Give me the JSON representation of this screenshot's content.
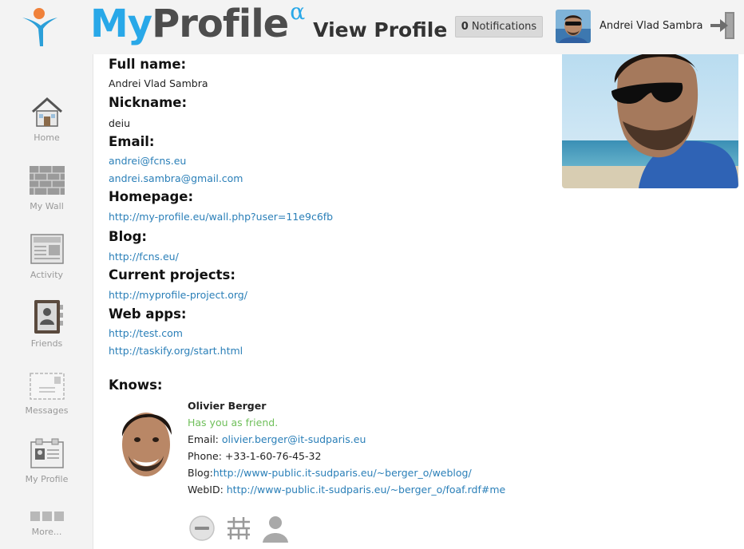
{
  "header": {
    "brand_my": "My",
    "brand_profile": "Profile",
    "brand_alpha": "α",
    "page_title": "View Profile",
    "notifications_count": "0",
    "notifications_label": "Notifications",
    "user_name": "Andrei Vlad Sambra"
  },
  "sidebar": {
    "items": [
      {
        "label": "Home",
        "icon": "house-icon"
      },
      {
        "label": "My Wall",
        "icon": "brick-wall-icon"
      },
      {
        "label": "Activity",
        "icon": "newspaper-icon"
      },
      {
        "label": "Friends",
        "icon": "address-book-icon"
      },
      {
        "label": "Messages",
        "icon": "envelope-icon"
      },
      {
        "label": "My Profile",
        "icon": "id-card-icon"
      },
      {
        "label": "More...",
        "icon": "more-icon"
      }
    ]
  },
  "profile": {
    "full_name_label": "Full name:",
    "full_name": "Andrei Vlad Sambra",
    "nickname_label": "Nickname:",
    "nickname": "deiu",
    "email_label": "Email:",
    "emails": [
      "andrei@fcns.eu",
      "andrei.sambra@gmail.com"
    ],
    "homepage_label": "Homepage:",
    "homepage": "http://my-profile.eu/wall.php?user=11e9c6fb",
    "blog_label": "Blog:",
    "blog": "http://fcns.eu/",
    "projects_label": "Current projects:",
    "projects": "http://myprofile-project.org/",
    "webapps_label": "Web apps:",
    "webapps": [
      "http://test.com",
      "http://taskify.org/start.html"
    ],
    "knows_label": "Knows:"
  },
  "friend": {
    "name": "Olivier Berger",
    "status": "Has you as friend.",
    "email_label": "Email: ",
    "email": "olivier.berger@it-sudparis.eu",
    "phone_label": "Phone: ",
    "phone": "+33-1-60-76-45-32",
    "blog_label": "Blog:",
    "blog": "http://www-public.it-sudparis.eu/~berger_o/weblog/",
    "webid_label": "WebID: ",
    "webid": "http://www-public.it-sudparis.eu/~berger_o/foaf.rdf#me",
    "actions": [
      "remove-friend-icon",
      "wall-icon",
      "person-icon"
    ]
  },
  "colors": {
    "accent_blue": "#29a8e8",
    "link": "#2a7fb8",
    "status_green": "#6fbf5a",
    "sidebar_bg": "#f3f3f3"
  }
}
